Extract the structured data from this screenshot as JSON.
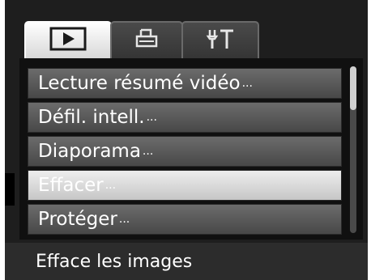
{
  "tabs": [
    {
      "icon": "play-icon",
      "active": true
    },
    {
      "icon": "print-icon",
      "active": false
    },
    {
      "icon": "tools-icon",
      "active": false
    }
  ],
  "menu": {
    "items": [
      {
        "label": "Lecture résumé vidéo",
        "ellipsis": "..."
      },
      {
        "label": "Défil. intell.",
        "ellipsis": "..."
      },
      {
        "label": "Diaporama",
        "ellipsis": "..."
      },
      {
        "label": "Effacer",
        "ellipsis": "...",
        "selected": true
      },
      {
        "label": "Protéger",
        "ellipsis": "..."
      }
    ]
  },
  "status": {
    "description": "Efface les images"
  },
  "colors": {
    "background": "#1e1e1e",
    "item": "#5a5a5a",
    "item_selected": "#dcdcdc",
    "text": "#ffffff"
  }
}
